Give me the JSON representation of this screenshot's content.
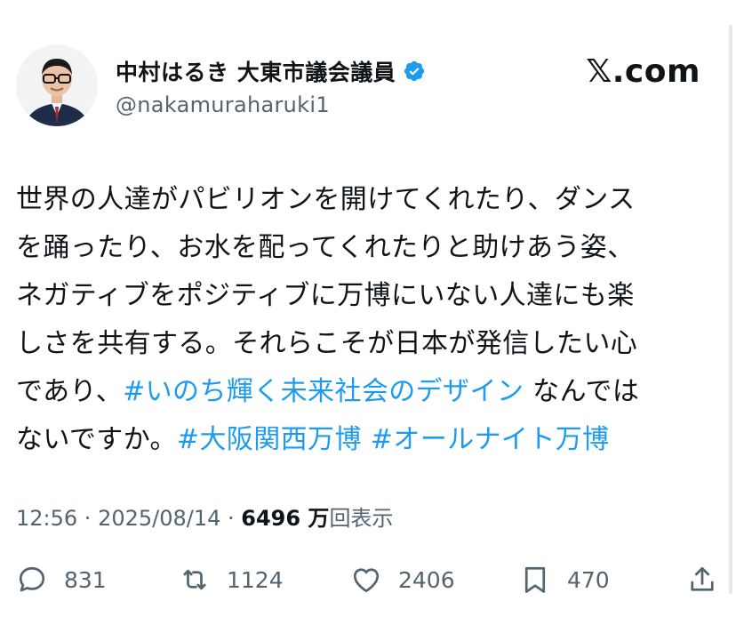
{
  "author": {
    "display_name": "中村はるき 大東市議会議員",
    "handle": "@nakamuraharuki1",
    "verified_color": "#1d9bf0"
  },
  "brand": "𝕏.com",
  "tweet": {
    "line1": "世界の人達がパビリオンを開けてくれたり、ダンス",
    "line2": "を踊ったり、お水を配ってくれたりと助けあう姿、",
    "line3": "ネガティブをポジティブに万博にいない人達にも楽",
    "line4": "しさを共有する。それらこそが日本が発信したい心",
    "line5_pre": "であり、",
    "hashtag1": "#いのち輝く未来社会のデザイン",
    "line5_post": " なんでは",
    "line6_pre": "ないですか。",
    "hashtag2": "#大阪関西万博",
    "hashtag3": "#オールナイト万博",
    "link_color": "#1d9bf0"
  },
  "meta": {
    "time": "12:56",
    "sep1": " · ",
    "date": "2025/08/14",
    "sep2": " · ",
    "views_count": "6496 万",
    "views_label": "回表示"
  },
  "actions": {
    "replies": "831",
    "reposts": "1124",
    "likes": "2406",
    "bookmarks": "470"
  }
}
